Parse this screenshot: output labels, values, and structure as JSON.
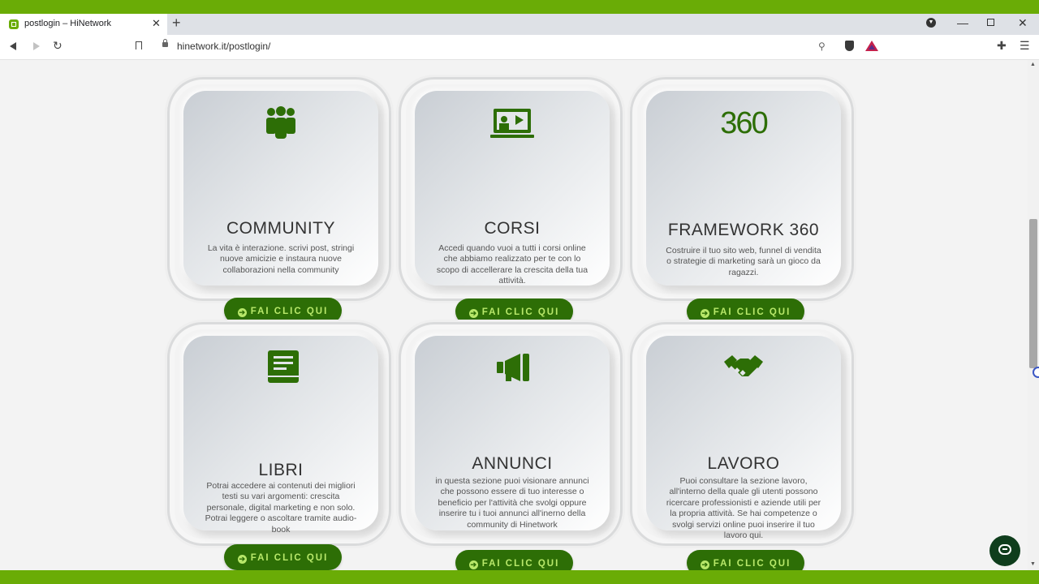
{
  "browser": {
    "tab_title": "postlogin – HiNetwork",
    "url": "hinetwork.it/postlogin/"
  },
  "colors": {
    "brand_green": "#6aac06",
    "button_green": "#2d6e06",
    "button_text": "#b8e86a"
  },
  "cards": [
    {
      "icon": "community-icon",
      "title": "COMMUNITY",
      "desc": "La vita è interazione. scrivi post, stringi nuove amicizie e instaura nuove collaborazioni nella community",
      "button": "FAI CLIC QUI"
    },
    {
      "icon": "courses-icon",
      "title": "CORSI",
      "desc": "Accedi quando vuoi a tutti i corsi online che abbiamo realizzato per te con lo scopo di accellerare la crescita della tua attività.",
      "button": "FAI CLIC QUI"
    },
    {
      "icon": "framework-360-icon",
      "icon_text": "360",
      "title": "FRAMEWORK 360",
      "desc": "Costruire il tuo sito web, funnel di vendita o strategie di marketing sarà un gioco da ragazzi.",
      "button": "FAI CLIC QUI"
    },
    {
      "icon": "book-icon",
      "title": "LIBRI",
      "desc": "Potrai accedere ai contenuti dei migliori testi su vari argomenti: crescita personale, digital marketing e non solo. Potrai leggere o ascoltare tramite audio-book",
      "button": "FAI CLIC QUI"
    },
    {
      "icon": "megaphone-icon",
      "title": "ANNUNCI",
      "desc": "in questa sezione puoi visionare annunci che possono essere di tuo interesse o beneficio per l'attività che svolgi oppure inserire tu i tuoi annunci all'inerno della community di Hinetwork",
      "button": "FAI CLIC QUI"
    },
    {
      "icon": "handshake-icon",
      "title": "LAVORO",
      "desc": "Puoi consultare la sezione lavoro, all'interno della quale gli utenti possono ricercare professionisti e aziende utili per la propria attività. Se hai competenze o svolgi servizi online puoi inserire il tuo lavoro qui.",
      "button": "FAI CLIC QUI"
    }
  ]
}
